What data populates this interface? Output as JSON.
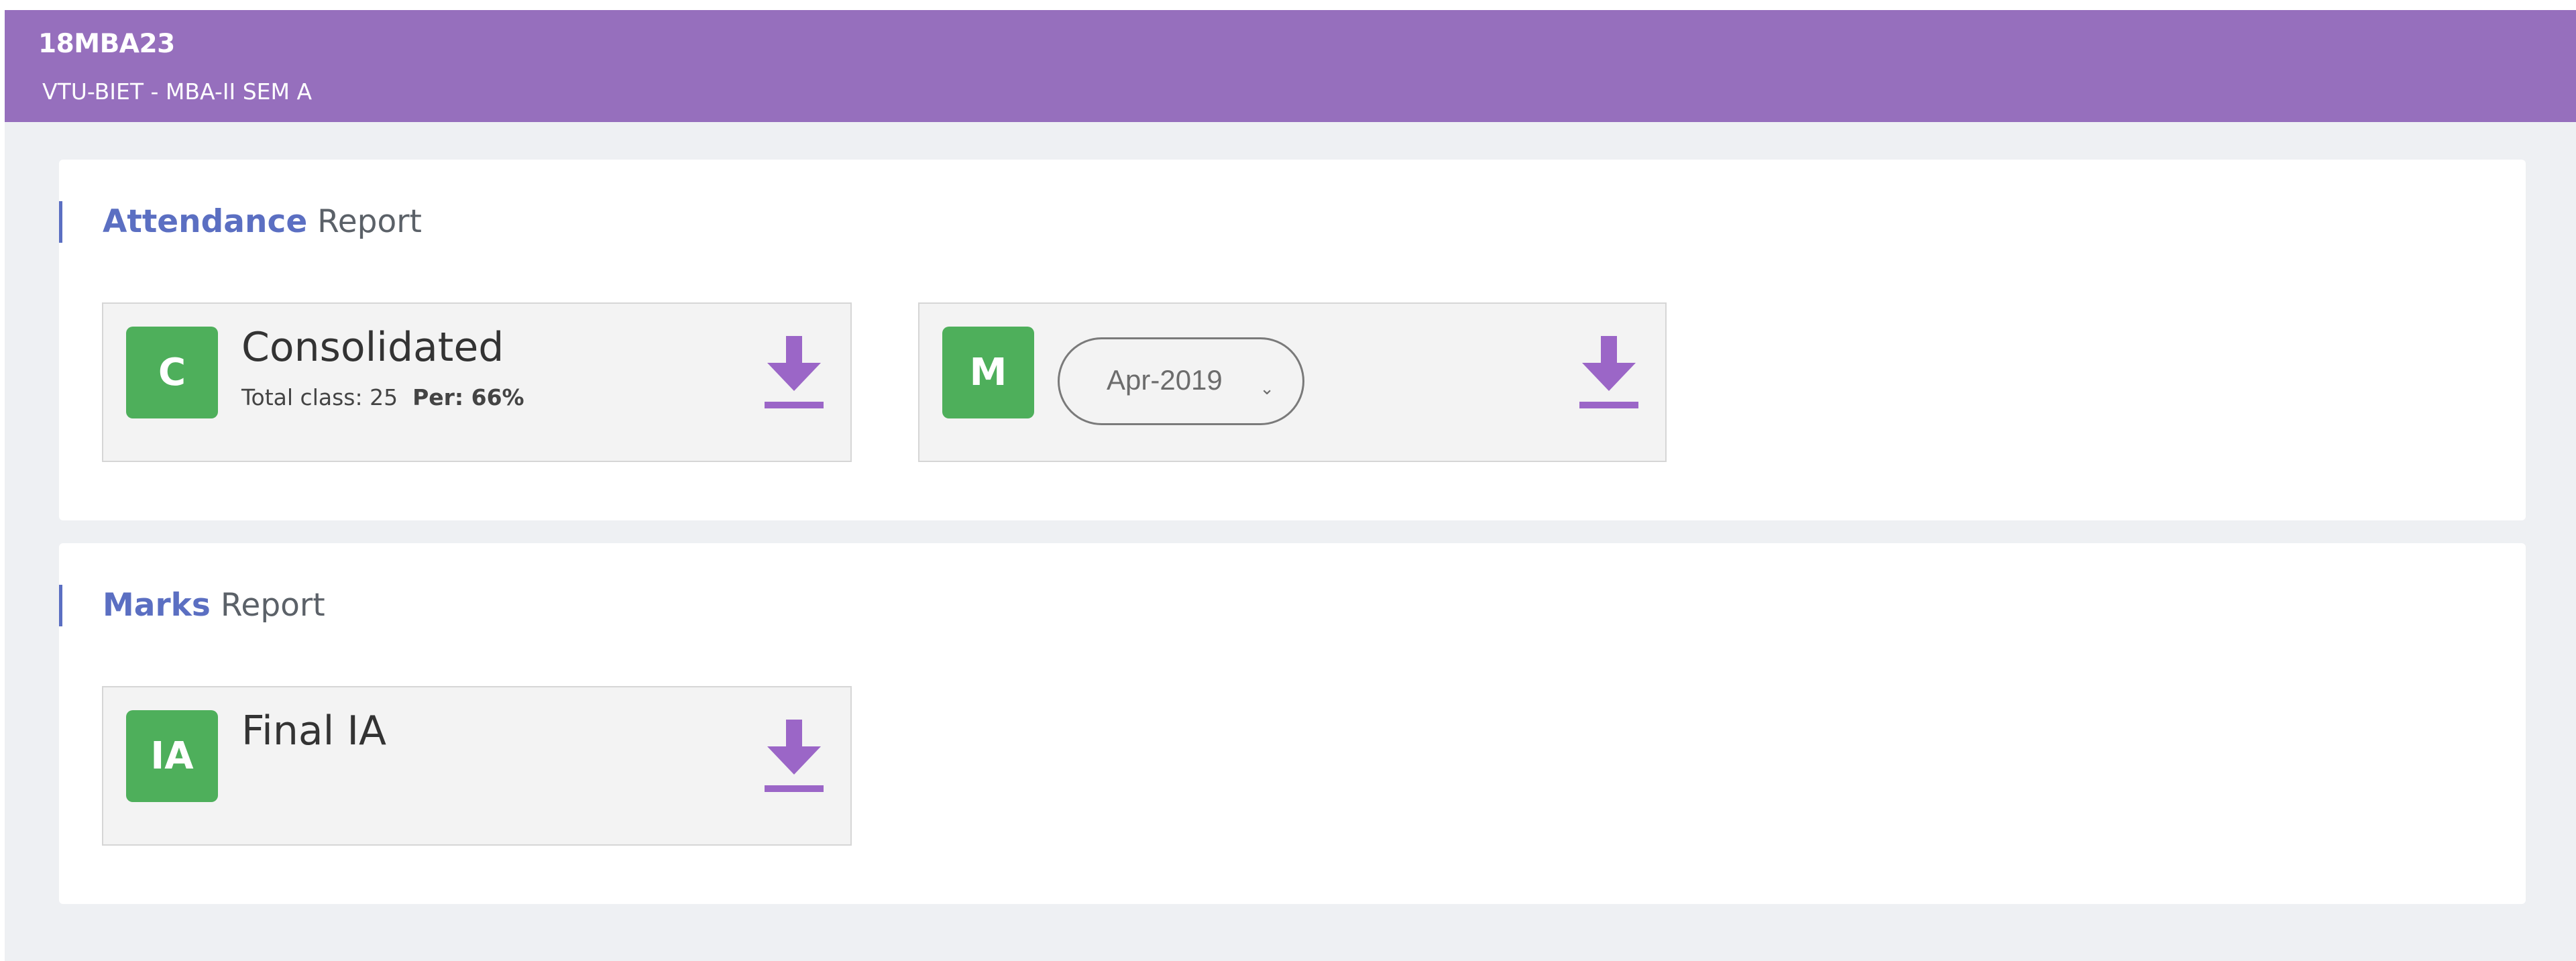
{
  "header": {
    "course_code": "18MBA23",
    "subtitle": "VTU-BIET - MBA-II SEM A",
    "background_color": "#966fbd"
  },
  "attendance_section": {
    "title_strong": "Attendance",
    "title_light": "Report",
    "consolidated_card": {
      "badge": "C",
      "title": "Consolidated",
      "total_class_text": "Total class: 25",
      "percentage_text": "Per: 66%",
      "download_icon": "download-icon"
    },
    "monthly_card": {
      "badge": "M",
      "month_select": {
        "selected": "Apr-2019",
        "caret_icon": "chevron-down-icon"
      },
      "download_icon": "download-icon"
    }
  },
  "marks_section": {
    "title_strong": "Marks",
    "title_light": "Report",
    "final_ia_card": {
      "badge": "IA",
      "title": "Final IA",
      "download_icon": "download-icon"
    }
  },
  "colors": {
    "accent_blue": "#5b6fc2",
    "badge_green": "#4eaf5b",
    "download_purple": "#9b66c7",
    "page_background": "#eef0f3"
  }
}
